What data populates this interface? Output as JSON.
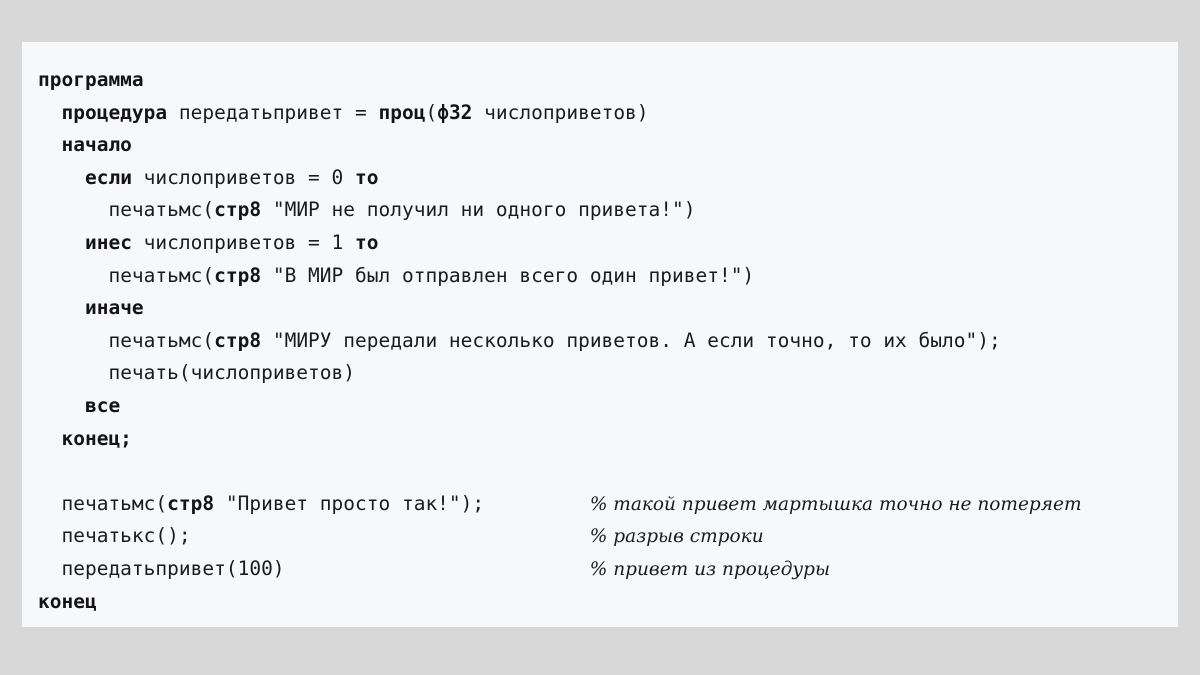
{
  "window": {
    "background_color": "#d8d8d8",
    "panel_color": "#f7f8fa",
    "text_color": "#1b1b1d"
  },
  "code": {
    "language_note": "russian-keyword pseudocode listing",
    "comment_prefix": "%",
    "lines": [
      {
        "id": "line-1",
        "indent": 0,
        "tokens": [
          {
            "t": "kw",
            "v": "программа"
          }
        ],
        "comment": ""
      },
      {
        "id": "line-2",
        "indent": 1,
        "tokens": [
          {
            "t": "kw",
            "v": "процедура"
          },
          {
            "t": "txt",
            "v": " передатьпривет = "
          },
          {
            "t": "kw",
            "v": "проц"
          },
          {
            "t": "txt",
            "v": "("
          },
          {
            "t": "kw",
            "v": "ф32"
          },
          {
            "t": "txt",
            "v": " числоприветов)"
          }
        ],
        "comment": ""
      },
      {
        "id": "line-3",
        "indent": 1,
        "tokens": [
          {
            "t": "kw",
            "v": "начало"
          }
        ],
        "comment": ""
      },
      {
        "id": "line-4",
        "indent": 2,
        "tokens": [
          {
            "t": "kw",
            "v": "если"
          },
          {
            "t": "txt",
            "v": " числоприветов = 0 "
          },
          {
            "t": "kw",
            "v": "то"
          }
        ],
        "comment": ""
      },
      {
        "id": "line-5",
        "indent": 3,
        "tokens": [
          {
            "t": "txt",
            "v": "печатьмс("
          },
          {
            "t": "kw",
            "v": "стр8"
          },
          {
            "t": "str",
            "v": " \"МИР не получил ни одного привета!\")"
          }
        ],
        "comment": ""
      },
      {
        "id": "line-6",
        "indent": 2,
        "tokens": [
          {
            "t": "kw",
            "v": "инес"
          },
          {
            "t": "txt",
            "v": " числоприветов = 1 "
          },
          {
            "t": "kw",
            "v": "то"
          }
        ],
        "comment": ""
      },
      {
        "id": "line-7",
        "indent": 3,
        "tokens": [
          {
            "t": "txt",
            "v": "печатьмс("
          },
          {
            "t": "kw",
            "v": "стр8"
          },
          {
            "t": "str",
            "v": " \"В МИР был отправлен всего один привет!\")"
          }
        ],
        "comment": ""
      },
      {
        "id": "line-8",
        "indent": 2,
        "tokens": [
          {
            "t": "kw",
            "v": "иначе"
          }
        ],
        "comment": ""
      },
      {
        "id": "line-9",
        "indent": 3,
        "tokens": [
          {
            "t": "txt",
            "v": "печатьмс("
          },
          {
            "t": "kw",
            "v": "стр8"
          },
          {
            "t": "str",
            "v": " \"МИРУ передали несколько приветов. А если точно, то их было\");"
          }
        ],
        "comment": ""
      },
      {
        "id": "line-10",
        "indent": 3,
        "tokens": [
          {
            "t": "txt",
            "v": "печать(числоприветов)"
          }
        ],
        "comment": ""
      },
      {
        "id": "line-11",
        "indent": 2,
        "tokens": [
          {
            "t": "kw",
            "v": "все"
          }
        ],
        "comment": ""
      },
      {
        "id": "line-12",
        "indent": 1,
        "tokens": [
          {
            "t": "kw",
            "v": "конец;"
          }
        ],
        "comment": ""
      },
      {
        "id": "line-13",
        "indent": 0,
        "tokens": [],
        "comment": ""
      },
      {
        "id": "line-14",
        "indent": 1,
        "tokens": [
          {
            "t": "txt",
            "v": "печатьмс("
          },
          {
            "t": "kw",
            "v": "стр8"
          },
          {
            "t": "str",
            "v": " \"Привет просто так!\");"
          }
        ],
        "comment": "% такой привет мартышка точно не потеряет"
      },
      {
        "id": "line-15",
        "indent": 1,
        "tokens": [
          {
            "t": "txt",
            "v": "печатькс();"
          }
        ],
        "comment": "% разрыв строки"
      },
      {
        "id": "line-16",
        "indent": 1,
        "tokens": [
          {
            "t": "txt",
            "v": "передатьпривет(100)"
          }
        ],
        "comment": "% привет из процедуры"
      },
      {
        "id": "line-17",
        "indent": 0,
        "tokens": [
          {
            "t": "kw",
            "v": "конец"
          }
        ],
        "comment": ""
      }
    ]
  }
}
